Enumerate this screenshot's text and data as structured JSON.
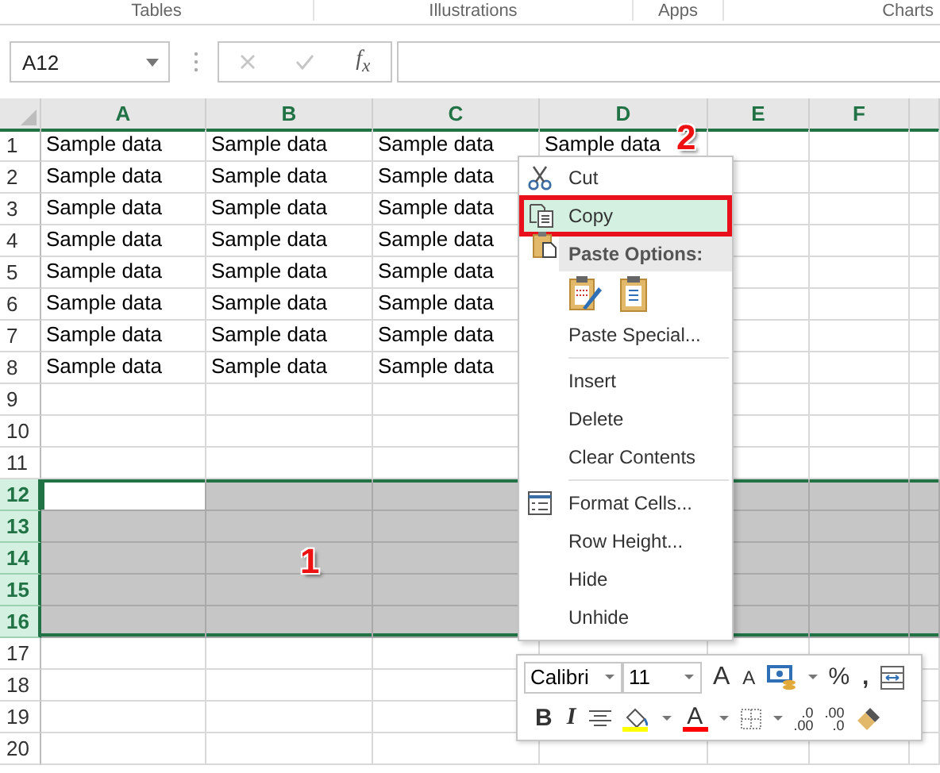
{
  "ribbon_groups": [
    {
      "label": "Tables"
    },
    {
      "label": "Illustrations"
    },
    {
      "label": "Apps"
    },
    {
      "label": "Charts"
    }
  ],
  "formula_bar": {
    "name_box": "A12",
    "insert_function": "f$_{x}$"
  },
  "sheet": {
    "columns": [
      "A",
      "B",
      "C",
      "D",
      "E",
      "F"
    ],
    "rows": [
      {
        "header": "1",
        "selected": false,
        "cells": [
          "Sample data",
          "Sample data",
          "Sample data",
          "Sample data"
        ]
      },
      {
        "header": "2",
        "selected": false,
        "cells": [
          "Sample data",
          "Sample data",
          "Sample data"
        ]
      },
      {
        "header": "3",
        "selected": false,
        "cells": [
          "Sample data",
          "Sample data",
          "Sample data"
        ]
      },
      {
        "header": "4",
        "selected": false,
        "cells": [
          "Sample data",
          "Sample data",
          "Sample data"
        ]
      },
      {
        "header": "5",
        "selected": false,
        "cells": [
          "Sample data",
          "Sample data",
          "Sample data"
        ]
      },
      {
        "header": "6",
        "selected": false,
        "cells": [
          "Sample data",
          "Sample data",
          "Sample data"
        ]
      },
      {
        "header": "7",
        "selected": false,
        "cells": [
          "Sample data",
          "Sample data",
          "Sample data"
        ]
      },
      {
        "header": "8",
        "selected": false,
        "cells": [
          "Sample data",
          "Sample data",
          "Sample data"
        ]
      },
      {
        "header": "9",
        "selected": false
      },
      {
        "header": "10",
        "selected": false
      },
      {
        "header": "11",
        "selected": false
      },
      {
        "header": "12",
        "selected": true,
        "active": true
      },
      {
        "header": "13",
        "selected": true
      },
      {
        "header": "14",
        "selected": true
      },
      {
        "header": "15",
        "selected": true
      },
      {
        "header": "16",
        "selected": true
      },
      {
        "header": "17",
        "selected": false
      },
      {
        "header": "18",
        "selected": false
      },
      {
        "header": "19",
        "selected": false
      },
      {
        "header": "20",
        "selected": false
      }
    ]
  },
  "context_menu": {
    "items": [
      {
        "kind": "item",
        "label": "Cut",
        "selected": false
      },
      {
        "kind": "item",
        "label": "Copy",
        "selected": true,
        "outlined": true
      },
      {
        "kind": "header",
        "label": "Paste Options:"
      },
      {
        "kind": "paste-icons"
      },
      {
        "kind": "item",
        "label": "Paste Special...",
        "selected": false
      },
      {
        "kind": "separator"
      },
      {
        "kind": "item",
        "label": "Insert",
        "selected": false
      },
      {
        "kind": "item",
        "label": "Delete",
        "selected": false
      },
      {
        "kind": "item",
        "label": "Clear Contents",
        "selected": false
      },
      {
        "kind": "separator"
      },
      {
        "kind": "item",
        "label": "Format Cells...",
        "selected": false
      },
      {
        "kind": "item",
        "label": "Row Height...",
        "selected": false
      },
      {
        "kind": "item",
        "label": "Hide",
        "selected": false
      },
      {
        "kind": "item",
        "label": "Unhide",
        "selected": false
      }
    ]
  },
  "mini_toolbar": {
    "font": "Calibri",
    "size": "11",
    "grow_font": "A",
    "shrink_font": "A",
    "percent": "%",
    "comma": ",",
    "bold": "B",
    "italic": "I",
    "font_color": "A",
    "increase_decimal": ".0\n.00",
    "decrease_decimal": ".00\n.0"
  },
  "annotations": [
    {
      "label": "1"
    },
    {
      "label": "2"
    }
  ]
}
